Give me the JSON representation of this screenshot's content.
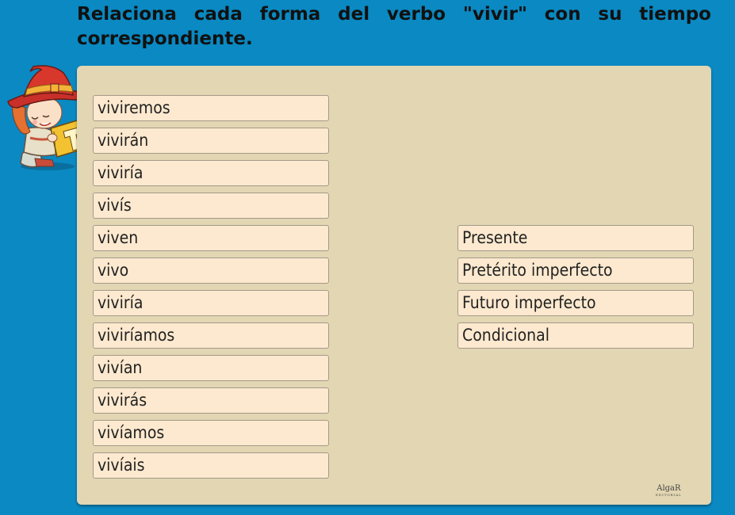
{
  "instruction": "Relaciona cada forma del verbo \"vivir\" con su tiempo correspondiente.",
  "verb_forms": [
    "viviremos",
    "vivirán",
    "viviría",
    "vivís",
    "viven",
    "vivo",
    "viviría",
    "viviríamos",
    "vivían",
    "vivirás",
    "vivíamos",
    "vivíais"
  ],
  "tenses": [
    "Presente",
    "Pretérito imperfecto",
    "Futuro imperfecto",
    "Condicional"
  ],
  "logo": {
    "name": "AlgaR",
    "sub": "EDITORIAL"
  },
  "colors": {
    "background": "#0a89c2",
    "board": "#e2d6b3",
    "tile": "#fde9cf",
    "tile_border": "#a39a88"
  },
  "icons": {
    "mascot": "witch-reading-book-icon"
  }
}
